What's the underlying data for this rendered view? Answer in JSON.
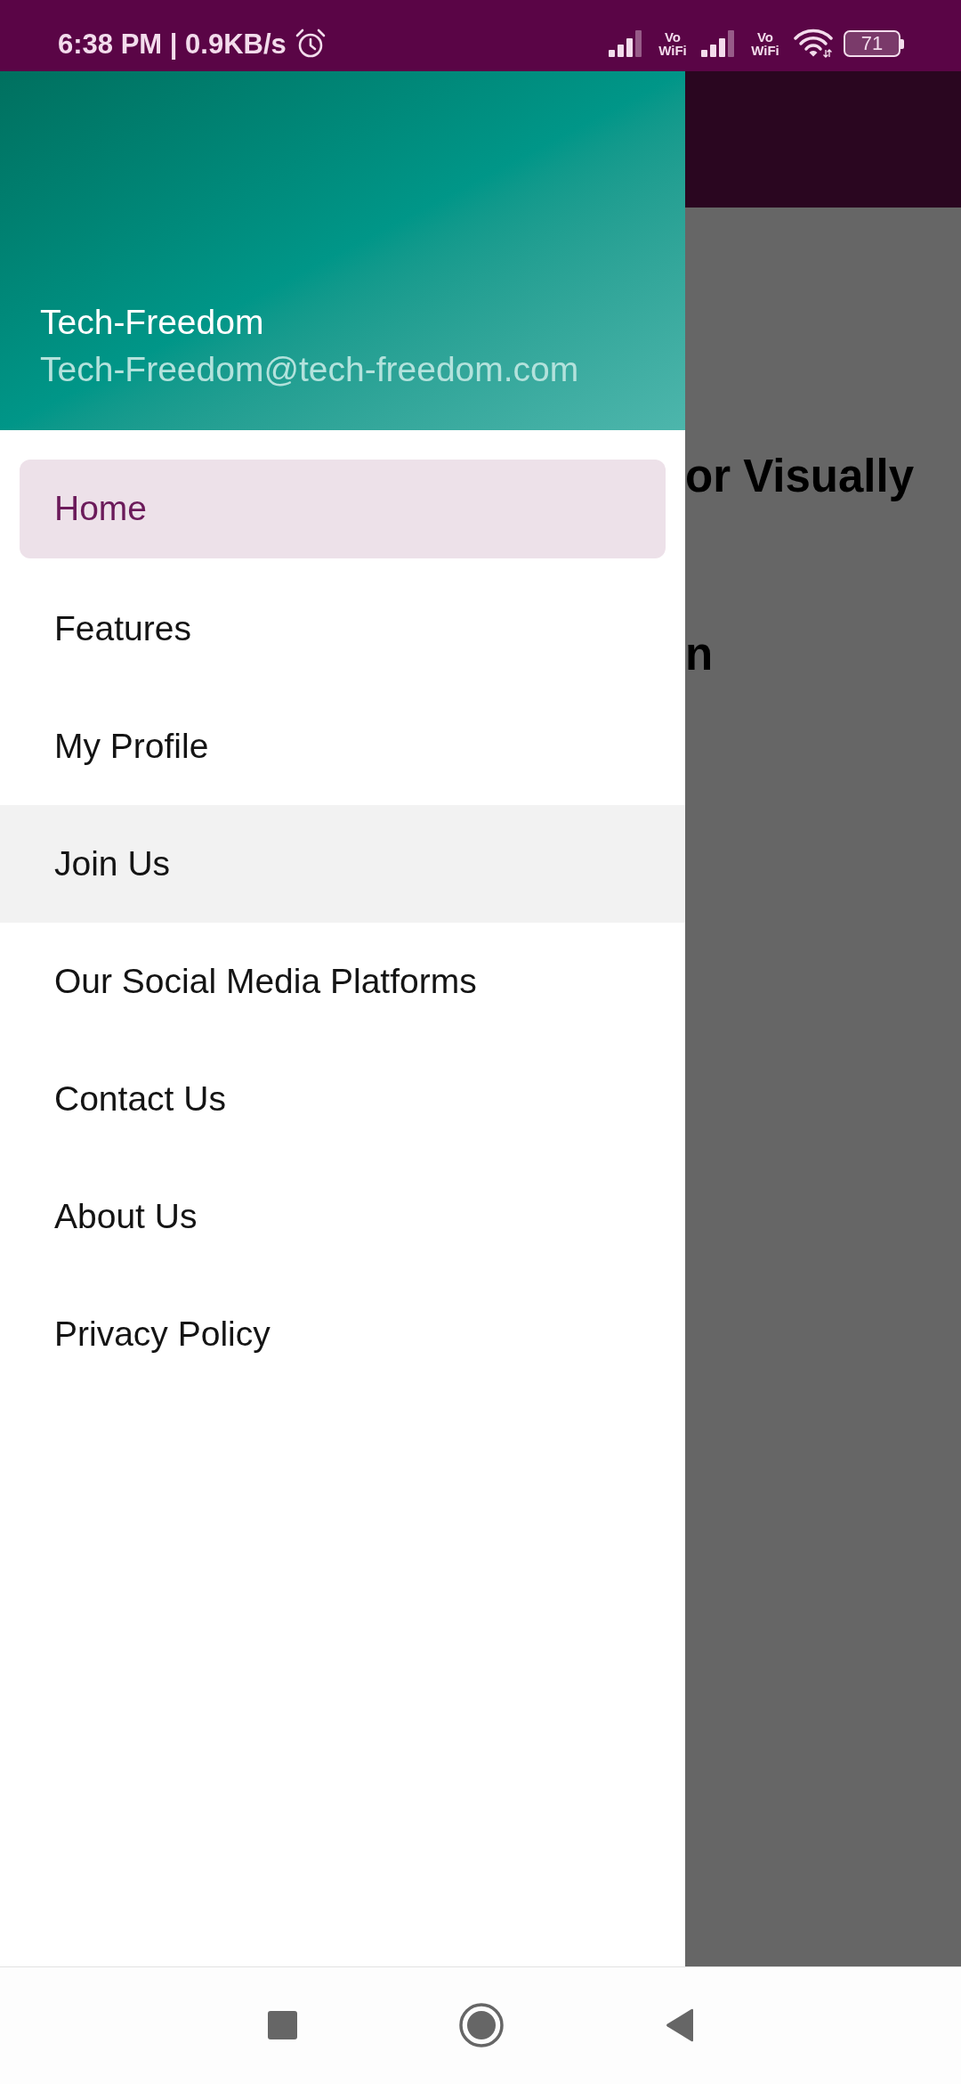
{
  "status_bar": {
    "time_and_speed": "6:38 PM | 0.9KB/s",
    "sim_labels": [
      "Vo WiFi",
      "Vo WiFi"
    ],
    "battery": "71"
  },
  "drawer": {
    "header": {
      "name": "Tech-Freedom",
      "email": "Tech-Freedom@tech-freedom.com"
    },
    "items": [
      {
        "label": "Home",
        "selected": true,
        "pressed": false
      },
      {
        "label": "Features",
        "selected": false,
        "pressed": false
      },
      {
        "label": "My Profile",
        "selected": false,
        "pressed": false
      },
      {
        "label": "Join Us",
        "selected": false,
        "pressed": true
      },
      {
        "label": "Our Social Media Platforms",
        "selected": false,
        "pressed": false
      },
      {
        "label": "Contact Us",
        "selected": false,
        "pressed": false
      },
      {
        "label": "About Us",
        "selected": false,
        "pressed": false
      },
      {
        "label": "Privacy Policy",
        "selected": false,
        "pressed": false
      }
    ]
  },
  "background_page": {
    "lines": [
      "or Visually",
      "n"
    ]
  }
}
